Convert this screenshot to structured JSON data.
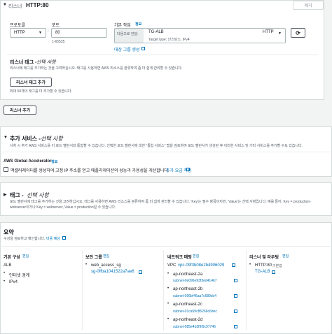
{
  "listener": {
    "caret": "▼",
    "title_prefix": "리스너",
    "title": "HTTP:80",
    "remove_label": "제거",
    "protocol_label": "프로토콜",
    "protocol_value": "HTTP",
    "port_label": "포트",
    "port_value": "80",
    "port_hint": "1-65535",
    "default_action_label": "기본 작업",
    "info_label": "정보",
    "forward_label": "다음으로 전달:",
    "target_group_name": "TG-ALB",
    "target_group_protocol": "HTTP",
    "target_type": "Target type: 인스턴스, IPv4",
    "create_target_group_link": "대상 그룹 생성",
    "tags_title": "리스너 태그 -",
    "tags_optional": "선택 사항",
    "tags_desc": "리스너에 태그를 추가하는 것을 고려하십시오. 태그를 사용하면 AWS 리소스를 분류하여 좀 더 쉽게 관리할 수 있습니다.",
    "add_tag_button": "리스너 태그 추가",
    "tag_limit": "최대 50개의 태그를 더 추가할 수 있습니다."
  },
  "add_listener_button": "리스너 추가",
  "addon": {
    "caret": "▼",
    "title": "추가 서비스 -",
    "optional": "선택 사항",
    "desc": "사차 시 추가 AWS 서비스를 이 로드 밸런서와 통합할 수 있습니다. 선택한 로드 밸런서에 대한 \"통합 서비스\" 탭을 검토하여 로드 밸런서가 생성된 후 이러한 서비스 및 기타 서비스를 추가할 수도 있습니다.",
    "ga_title": "AWS Global Accelerator",
    "ga_info": "정보",
    "ga_checkbox_label": "액셀러레이터를 생성하여 고정 IP 주소를 얻고 애플리케이션의 성능과 가용성을 개선합니다.",
    "ga_pricing_link": "추가 요금 적용"
  },
  "tags_section": {
    "caret": "▶",
    "title": "태그 -",
    "optional": "선택 사항",
    "desc_line1": "로드 밸런서에 태그를 추가하는 것을 고려하십시오. 태그를 사용하면 AWS 리소스를 분류하여 좀 더 쉽게 관리할 수 있습니다. 'Key'는 필수 항목이지만, 'Value'는 선택 사항입니다. 예를 들어, Key = production-",
    "desc_line2": "webserver이거나 Key = webserver, Value = production일 수 있습니다."
  },
  "summary": {
    "title": "요약",
    "desc": "구성을 검토하고 확인합니다.",
    "pricing_link": "비용 예상",
    "basic": {
      "title": "기본 구성",
      "edit": "편집",
      "items": [
        "ALB",
        "인터넷 경계",
        "IPv4"
      ]
    },
    "security": {
      "title": "보안 그룹",
      "edit": "편집",
      "group_name": "web_access_sg",
      "group_id": "sg-0ffba1041522a7ae6"
    },
    "network": {
      "title": "네트워크 매핑",
      "edit": "편집",
      "vpc_label": "VPC",
      "vpc_id": "vpc-09f3b08e2b4906029",
      "zones": [
        {
          "az": "ap-northeast-2a",
          "subnet": "subnet-0e096e93f3ed41467"
        },
        {
          "az": "ap-northeast-2b",
          "subnet": "subnet-096bf46aa7c689dc4"
        },
        {
          "az": "ap-northeast-2c",
          "subnet": "subnet-01ca59c85266c6dec"
        },
        {
          "az": "ap-northeast-2d",
          "subnet": "subnet-085e4b3f9f9c97746"
        }
      ]
    },
    "listeners": {
      "title": "리스너 및 라우팅",
      "edit": "편집",
      "listener": "HTTP:80",
      "listener_suffix": "기본값",
      "target": "TG-ALB"
    }
  }
}
